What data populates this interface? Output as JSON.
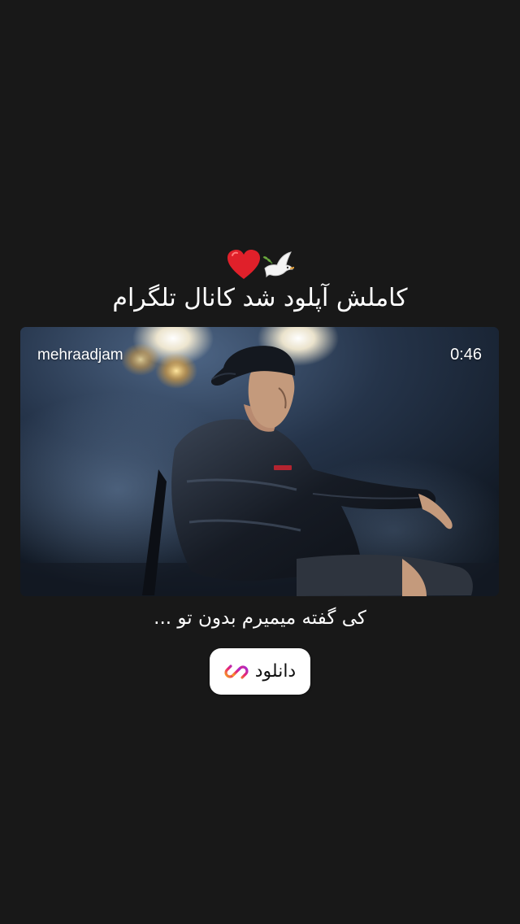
{
  "story": {
    "emojis": [
      "heart-icon",
      "dove-icon"
    ],
    "title": "کاملش  آپلود شد کانال تلگرام",
    "video": {
      "username": "mehraadjam",
      "duration": "0:46"
    },
    "caption": "کی گفته میمیرم بدون تو ...",
    "link_sticker": {
      "label": "دانلود",
      "icon": "link-icon"
    }
  },
  "colors": {
    "background": "#181818",
    "heart": "#e0202a",
    "link_gradient_start": "#f8a21c",
    "link_gradient_mid": "#e8236f",
    "link_gradient_end": "#a32bd8"
  }
}
